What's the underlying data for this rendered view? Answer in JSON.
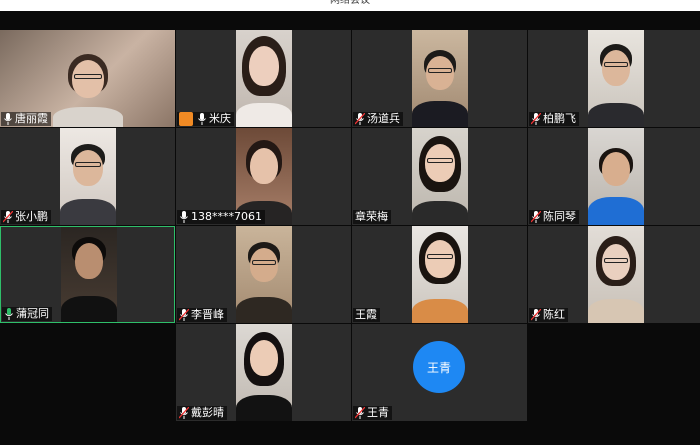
{
  "window": {
    "title": "网络会议"
  },
  "participants": [
    {
      "name": "唐丽霞",
      "host": false
    },
    {
      "name": "米庆",
      "host": true
    },
    {
      "name": "汤道兵",
      "host": false
    },
    {
      "name": "柏鹏飞",
      "host": false
    },
    {
      "name": "张小鹏",
      "host": false
    },
    {
      "name": "138****7061",
      "host": false
    },
    {
      "name": "章荣梅",
      "host": false
    },
    {
      "name": "陈同琴",
      "host": false
    },
    {
      "name": "蒲冠同",
      "host": false
    },
    {
      "name": "李晋峰",
      "host": false
    },
    {
      "name": "王霞",
      "host": false
    },
    {
      "name": "陈红",
      "host": false
    },
    {
      "name": "戴彭晴",
      "host": false
    },
    {
      "name": "王青",
      "host": false,
      "avatar_text": "王青"
    }
  ],
  "colors": {
    "tile": "#2c2c2c",
    "active_border": "#2fbf6a",
    "avatar": "#1e88f3",
    "host_badge": "#f08a24"
  }
}
